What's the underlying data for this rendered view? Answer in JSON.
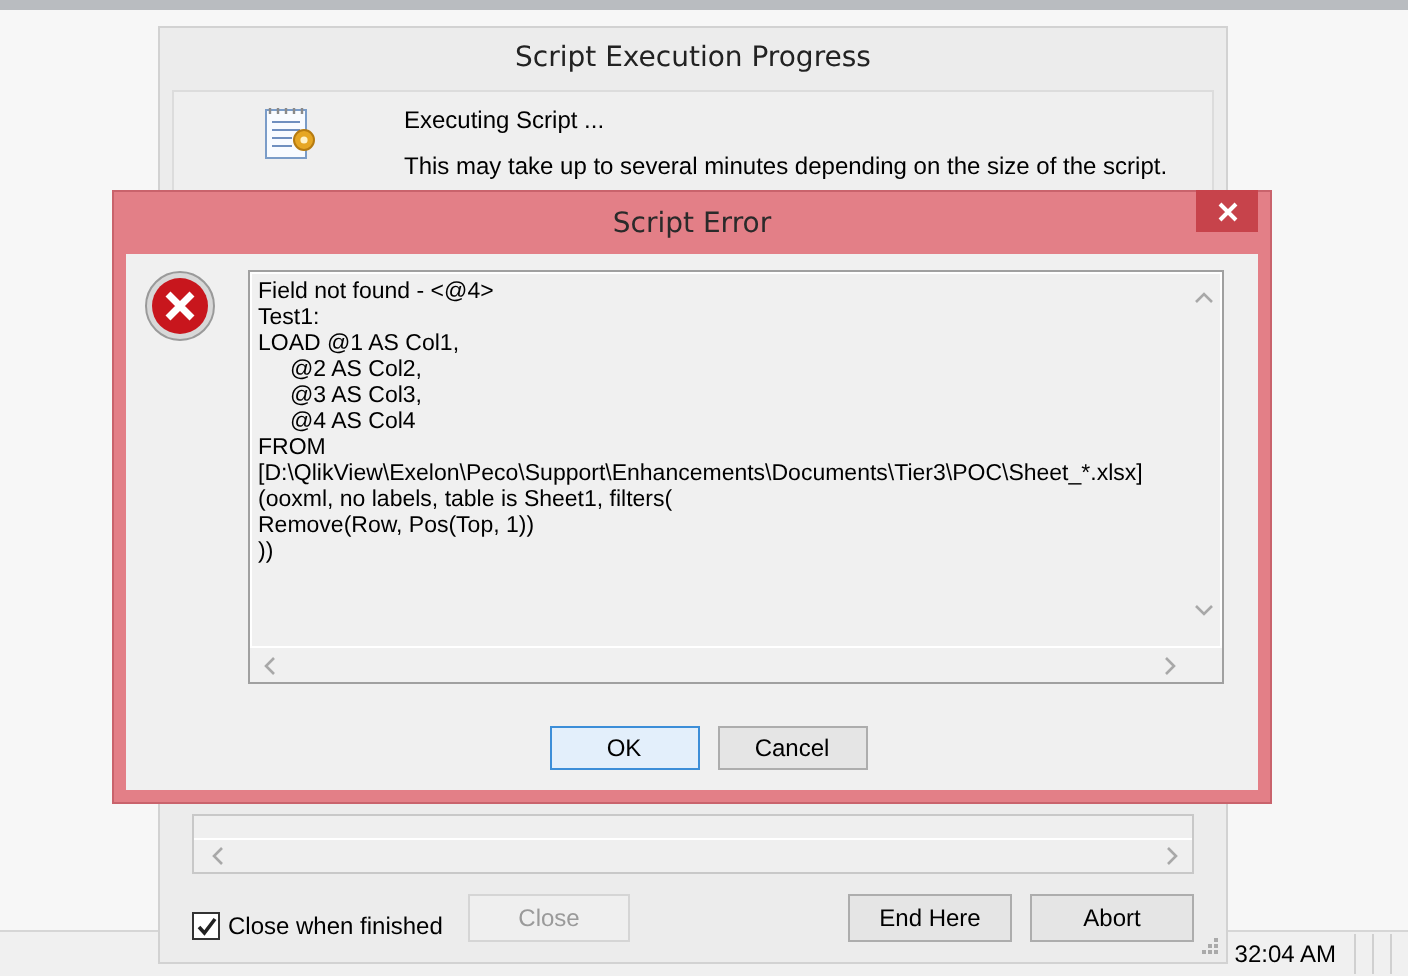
{
  "back_window": {
    "title": "Script Execution Progress",
    "status": "Executing Script ...",
    "note": "This may take up to several minutes depending on the size of the script.",
    "close_when_finished": {
      "label": "Close when finished",
      "checked": true
    },
    "buttons": [
      {
        "label": "Close",
        "disabled": true
      },
      {
        "label": "End Here",
        "disabled": false
      },
      {
        "label": "Abort",
        "disabled": false
      }
    ]
  },
  "error_dialog": {
    "title": "Script Error",
    "message_lines": [
      "Field not found - <@4>",
      "Test1:",
      "LOAD @1 AS Col1,",
      "     @2 AS Col2,",
      "     @3 AS Col3,",
      "     @4 AS Col4",
      "FROM",
      "[D:\\QlikView\\Exelon\\Peco\\Support\\Enhancements\\Documents\\Tier3\\POC\\Sheet_*.xlsx]",
      "(ooxml, no labels, table is Sheet1, filters(",
      "Remove(Row, Pos(Top, 1))",
      "))"
    ],
    "buttons": [
      {
        "label": "OK",
        "default": true
      },
      {
        "label": "Cancel",
        "default": false
      }
    ]
  },
  "status_bar": {
    "clock": "32:04 AM"
  }
}
